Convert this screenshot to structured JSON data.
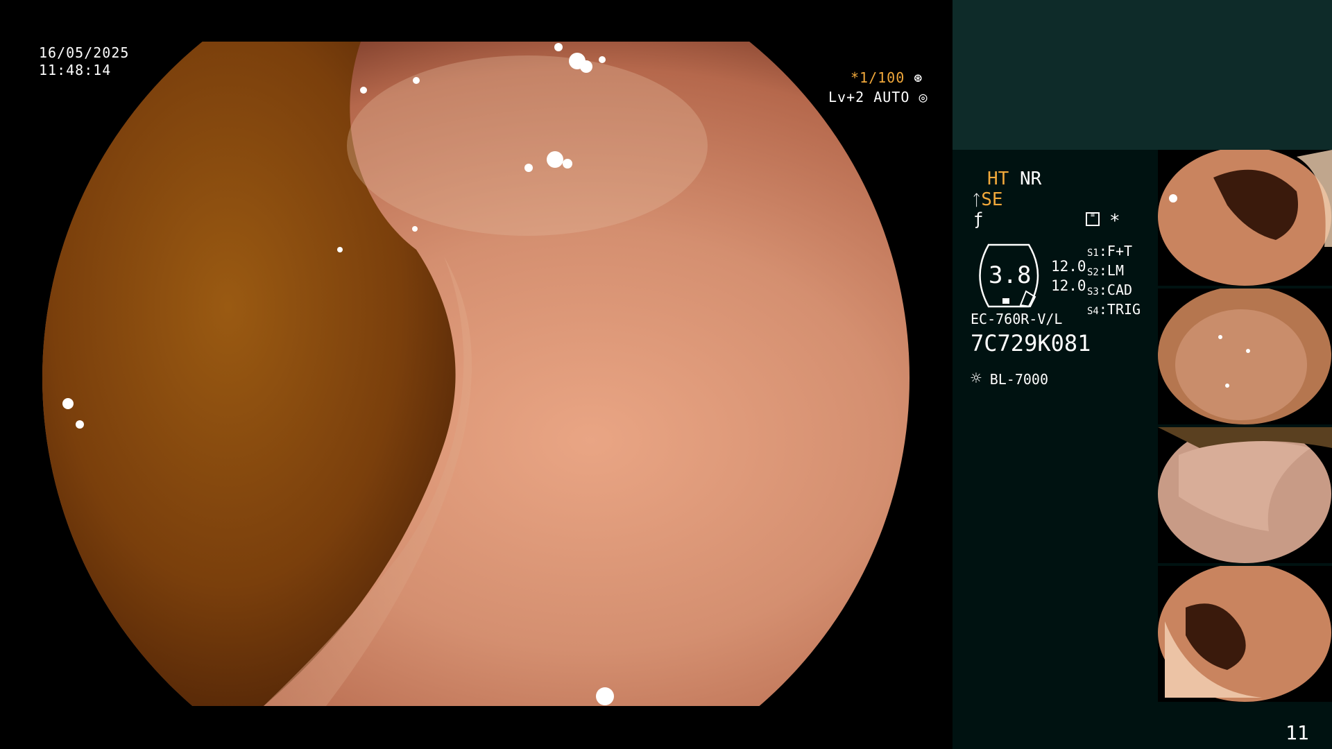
{
  "overlay": {
    "date": "16/05/2025",
    "time": "11:48:14",
    "shutter": "*1/100",
    "shutter_icon": "aperture-icon",
    "level": "Lv+2",
    "mode": "AUTO",
    "mode_icon": "iris-icon"
  },
  "panel": {
    "ht": "HT",
    "nr": "NR",
    "se": "SE",
    "se_icon": "structure-enhance-icon",
    "f_icon": "f-curve-icon",
    "memo_icon": "memo-icon",
    "asterisk": "*",
    "gauge_value": "3.8",
    "values": [
      "12.0",
      "12.0"
    ],
    "switches": [
      {
        "key": "S1",
        "value": "F+T"
      },
      {
        "key": "S2",
        "value": "LM"
      },
      {
        "key": "S3",
        "value": "CAD"
      },
      {
        "key": "S4",
        "value": "TRIG"
      }
    ],
    "scope_model": "EC-760R-V/L",
    "serial": "7C729K081",
    "light_icon": "light-source-icon",
    "light_source": "BL-7000",
    "page_number": "11"
  },
  "thumbnails": [
    {
      "name": "captured-image-1"
    },
    {
      "name": "captured-image-2"
    },
    {
      "name": "captured-image-3"
    },
    {
      "name": "captured-image-4"
    }
  ],
  "colors": {
    "accent_orange": "#f2a93b",
    "panel_bg": "#001211",
    "panel_top_bg": "#0e2b29"
  }
}
